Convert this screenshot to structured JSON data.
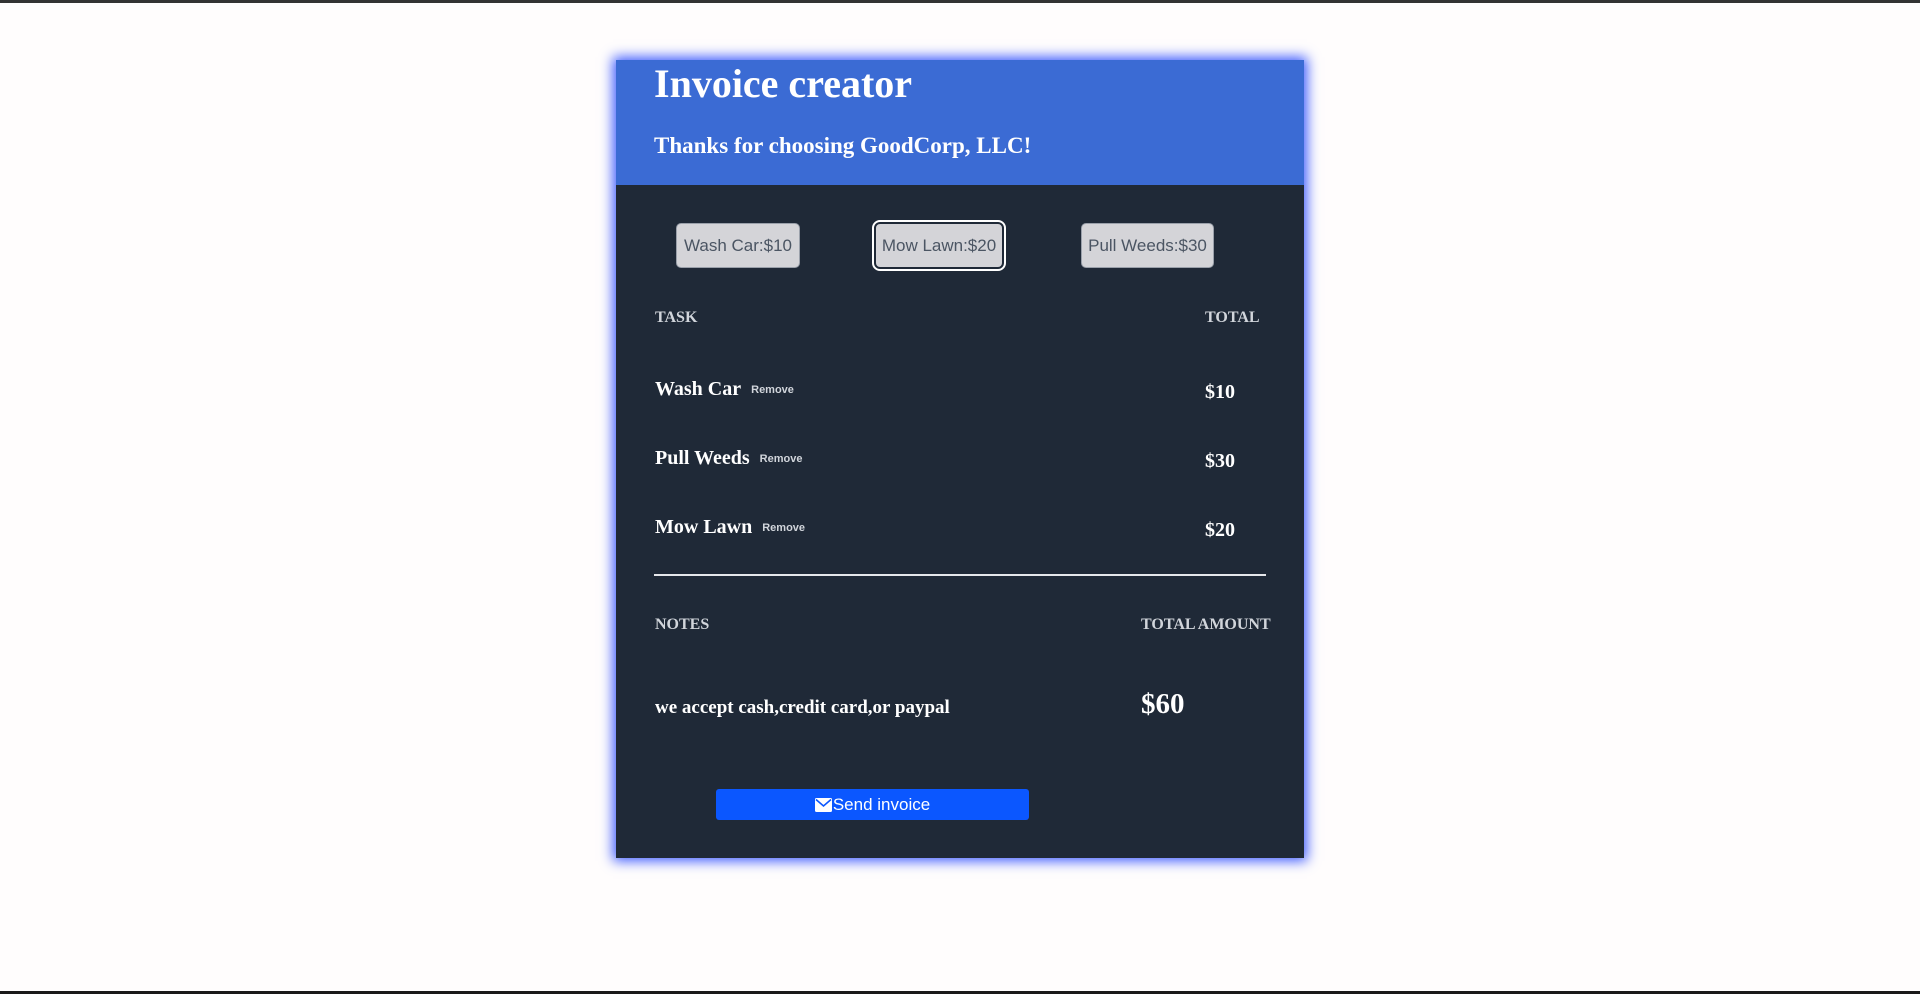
{
  "header": {
    "title": "Invoice creator",
    "subtitle": "Thanks for choosing GoodCorp, LLC!"
  },
  "task_buttons": [
    {
      "label": "Wash Car:$10"
    },
    {
      "label": "Mow Lawn:$20"
    },
    {
      "label": "Pull Weeds:$30"
    }
  ],
  "table": {
    "task_header": "TASK",
    "total_header": "TOTAL",
    "rows": [
      {
        "name": "Wash Car",
        "remove_label": "Remove",
        "total": "$10"
      },
      {
        "name": "Pull Weeds",
        "remove_label": "Remove",
        "total": "$30"
      },
      {
        "name": "Mow Lawn",
        "remove_label": "Remove",
        "total": "$20"
      }
    ]
  },
  "summary": {
    "notes_header": "NOTES",
    "total_amount_header": "TOTAL AMOUNT",
    "notes_text": "we accept cash,credit card,or paypal",
    "total_amount": "$60"
  },
  "send_button": {
    "label": "Send invoice",
    "icon": "envelope-icon"
  },
  "colors": {
    "header_bg": "#3b6bd4",
    "card_bg": "#1f2937",
    "send_button_bg": "#0b57ff"
  }
}
